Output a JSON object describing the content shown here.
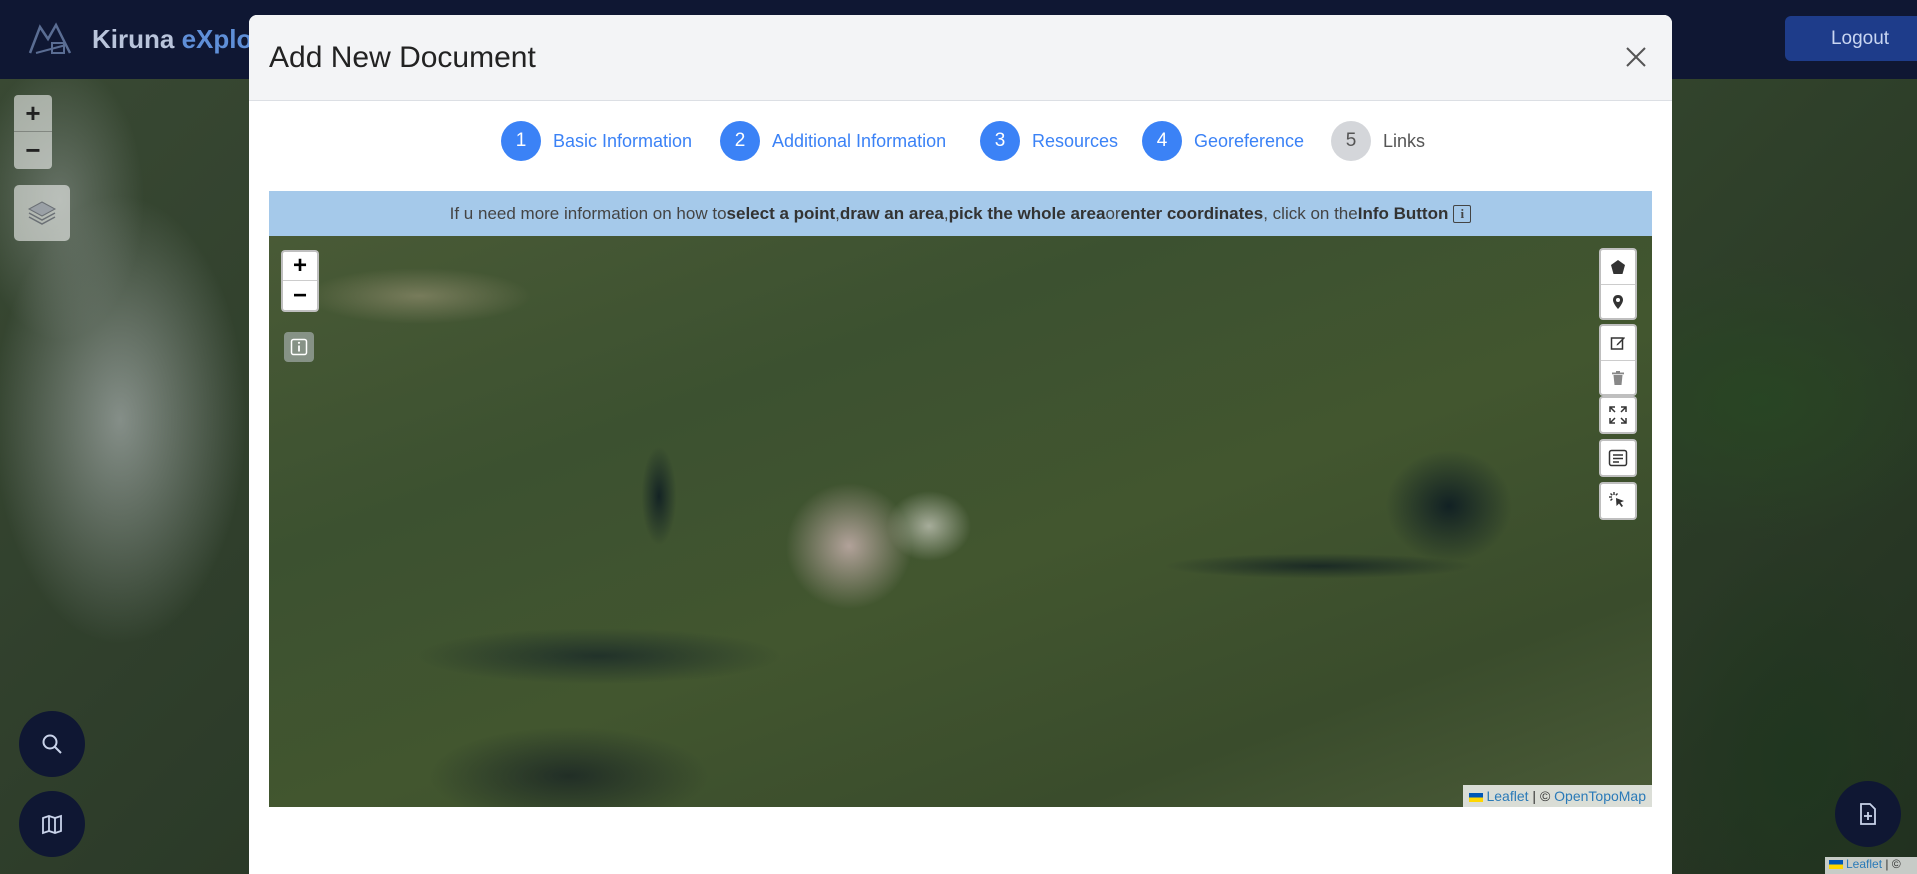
{
  "app": {
    "name_part1": "Kiruna ",
    "name_part2": "eXplore",
    "logout_label": "Logout"
  },
  "background_map": {
    "zoom_in": "+",
    "zoom_out": "−",
    "attribution_link": "Leaflet",
    "attribution_rest": " | ©"
  },
  "modal": {
    "title": "Add New Document",
    "steps": [
      {
        "number": "1",
        "label": "Basic Information",
        "state": "completed"
      },
      {
        "number": "2",
        "label": "Additional Information",
        "state": "completed"
      },
      {
        "number": "3",
        "label": "Resources",
        "state": "completed"
      },
      {
        "number": "4",
        "label": "Georeference",
        "state": "active"
      },
      {
        "number": "5",
        "label": "Links",
        "state": "pending"
      }
    ],
    "info_banner": {
      "prefix": "If u need more information on how to ",
      "select_point": "select a point",
      "sep1": ", ",
      "draw_area": "draw an area",
      "sep2": ", ",
      "whole_area": "pick the whole area",
      "or": " or ",
      "enter_coords": "enter coordinates",
      "middle": " , click on the ",
      "info_button": "Info Button",
      "info_glyph": "i"
    },
    "map": {
      "zoom_in": "+",
      "zoom_out": "−",
      "attribution_leaflet": "Leaflet",
      "attribution_sep": " | © ",
      "attribution_provider": "OpenTopoMap"
    }
  },
  "colors": {
    "navbar": "#0f1733",
    "primary_step": "#3b82f6",
    "info_banner": "#a5c9ea",
    "logout_bg": "#1e3c8a"
  }
}
